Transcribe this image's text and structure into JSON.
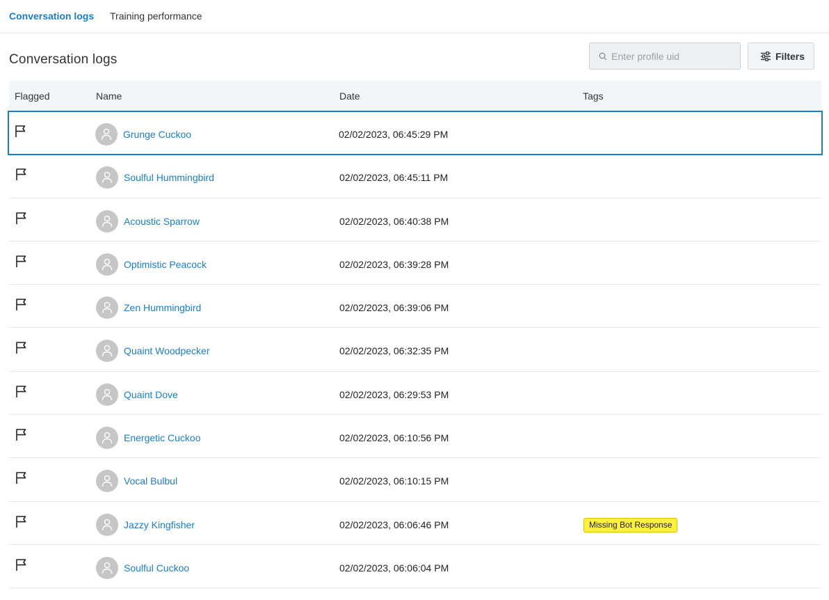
{
  "tabs": [
    {
      "label": "Conversation logs",
      "active": true
    },
    {
      "label": "Training performance",
      "active": false
    }
  ],
  "page_title": "Conversation logs",
  "search": {
    "placeholder": "Enter profile uid",
    "value": "",
    "icon": "search-icon"
  },
  "filters": {
    "label": "Filters",
    "icon": "sliders-icon"
  },
  "table": {
    "columns": [
      "Flagged",
      "Name",
      "Date",
      "Tags"
    ],
    "rows": [
      {
        "name": "Grunge Cuckoo",
        "date": "02/02/2023, 06:45:29 PM",
        "tag": ""
      },
      {
        "name": "Soulful Hummingbird",
        "date": "02/02/2023, 06:45:11 PM",
        "tag": ""
      },
      {
        "name": "Acoustic Sparrow",
        "date": "02/02/2023, 06:40:38 PM",
        "tag": ""
      },
      {
        "name": "Optimistic Peacock",
        "date": "02/02/2023, 06:39:28 PM",
        "tag": ""
      },
      {
        "name": "Zen Hummingbird",
        "date": "02/02/2023, 06:39:06 PM",
        "tag": ""
      },
      {
        "name": "Quaint Woodpecker",
        "date": "02/02/2023, 06:32:35 PM",
        "tag": ""
      },
      {
        "name": "Quaint Dove",
        "date": "02/02/2023, 06:29:53 PM",
        "tag": ""
      },
      {
        "name": "Energetic Cuckoo",
        "date": "02/02/2023, 06:10:56 PM",
        "tag": ""
      },
      {
        "name": "Vocal Bulbul",
        "date": "02/02/2023, 06:10:15 PM",
        "tag": ""
      },
      {
        "name": "Jazzy Kingfisher",
        "date": "02/02/2023, 06:06:46 PM",
        "tag": "Missing Bot Response"
      },
      {
        "name": "Soulful Cuckoo",
        "date": "02/02/2023, 06:06:04 PM",
        "tag": ""
      }
    ],
    "selected_row": 0
  },
  "colors": {
    "accent": "#1a7ec4",
    "tag_bg": "#fdf03f",
    "header_bg": "#f3f6f9"
  }
}
